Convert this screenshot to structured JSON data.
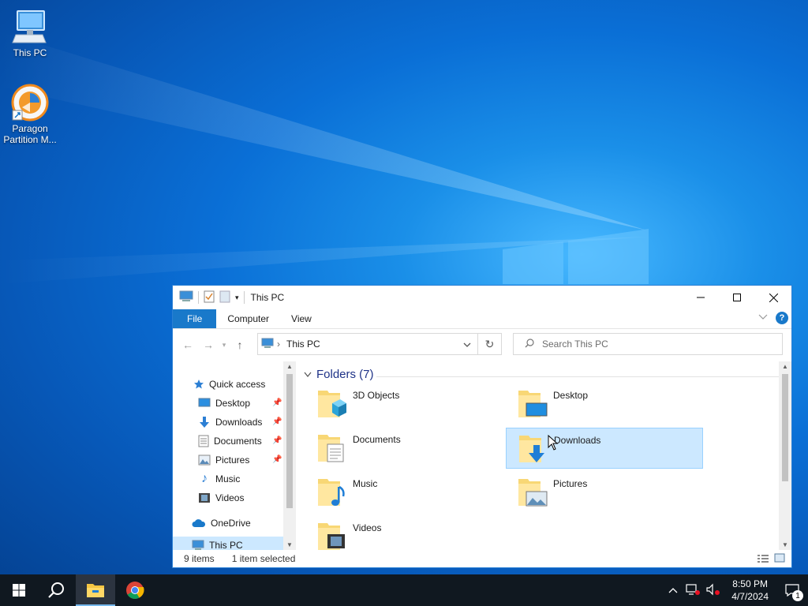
{
  "desktop": {
    "icons": [
      {
        "label": "This PC",
        "icon": "monitor-icon"
      },
      {
        "label": "Paragon Partition M...",
        "icon": "paragon-icon"
      }
    ]
  },
  "window": {
    "title": "This PC",
    "ribbon_tabs": [
      "File",
      "Computer",
      "View"
    ],
    "address": {
      "path": "This PC"
    },
    "search_placeholder": "Search This PC",
    "nav_pane": {
      "quick_access": "Quick access",
      "quick_items": [
        "Desktop",
        "Downloads",
        "Documents",
        "Pictures",
        "Music",
        "Videos"
      ],
      "onedrive": "OneDrive",
      "this_pc": "This PC"
    },
    "group_title": "Folders (7)",
    "folders": [
      {
        "label": "3D Objects",
        "icon": "3d-objects-icon"
      },
      {
        "label": "Desktop",
        "icon": "desktop-folder-icon"
      },
      {
        "label": "Documents",
        "icon": "documents-folder-icon"
      },
      {
        "label": "Downloads",
        "icon": "downloads-folder-icon",
        "selected": true
      },
      {
        "label": "Music",
        "icon": "music-folder-icon"
      },
      {
        "label": "Pictures",
        "icon": "pictures-folder-icon"
      },
      {
        "label": "Videos",
        "icon": "videos-folder-icon"
      }
    ],
    "status": {
      "items": "9 items",
      "selected": "1 item selected"
    }
  },
  "taskbar": {
    "time": "8:50 PM",
    "date": "4/7/2024",
    "notification_count": "1"
  },
  "colors": {
    "accent": "#1979ca",
    "selection": "#cce8ff",
    "taskbar": "#101820"
  }
}
